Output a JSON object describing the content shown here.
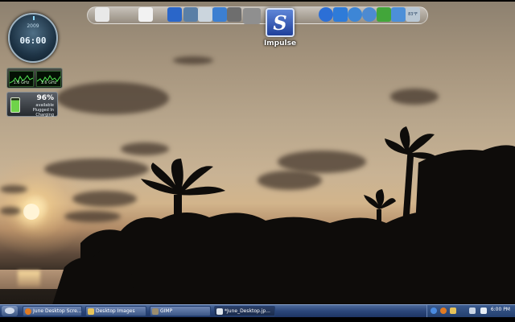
{
  "dock": {
    "items": [
      {
        "name": "folder-icon",
        "color": "#e8e8e8"
      },
      {
        "name": "document-icon",
        "color": "#f2f2f2"
      },
      {
        "name": "pencil-icon",
        "color": "#2a66c9"
      },
      {
        "name": "ipod-icon",
        "color": "#5a7fa6"
      },
      {
        "name": "photos-icon",
        "color": "#cbd5dd"
      },
      {
        "name": "monitor-icon",
        "color": "#3c7fd1"
      },
      {
        "name": "tools-icon",
        "color": "#6e6e6e"
      },
      {
        "name": "gimp-icon",
        "color": "#8f8f8f"
      },
      {
        "name": "globe-icon",
        "color": "#2c6fd6"
      },
      {
        "name": "chart-icon",
        "color": "#2e7bd8"
      },
      {
        "name": "compass-icon",
        "color": "#3d86d6"
      },
      {
        "name": "magnifier-icon",
        "color": "#4d8ad1"
      },
      {
        "name": "chat-icon",
        "color": "#42a63a"
      },
      {
        "name": "gear-icon",
        "color": "#4c8fd8"
      },
      {
        "name": "weather-icon",
        "color": "#b9c7d3"
      }
    ],
    "weather_text": "83°F"
  },
  "impulse": {
    "label": "Impulse",
    "glyph": "S"
  },
  "clock": {
    "date": "2009",
    "time": "06:00"
  },
  "cpu": {
    "core1": "1.6 GHz",
    "core2": "1.6 GHz"
  },
  "battery": {
    "percent": "96%",
    "line1": "available",
    "line2": "Plugged In",
    "line3": "Charging"
  },
  "taskbar": {
    "tasks": [
      {
        "label": "June Desktop Scre...",
        "icon": "firefox-icon",
        "color": "#e07a22"
      },
      {
        "label": "Desktop Images",
        "icon": "folder-icon",
        "color": "#e6c35a"
      },
      {
        "label": "GIMP",
        "icon": "gimp-icon",
        "color": "#9b8d6f"
      },
      {
        "label": "*June_Desktop.jp...",
        "icon": "image-icon",
        "color": "#dfe6ee"
      }
    ],
    "tray_time": "6:00 PM"
  }
}
